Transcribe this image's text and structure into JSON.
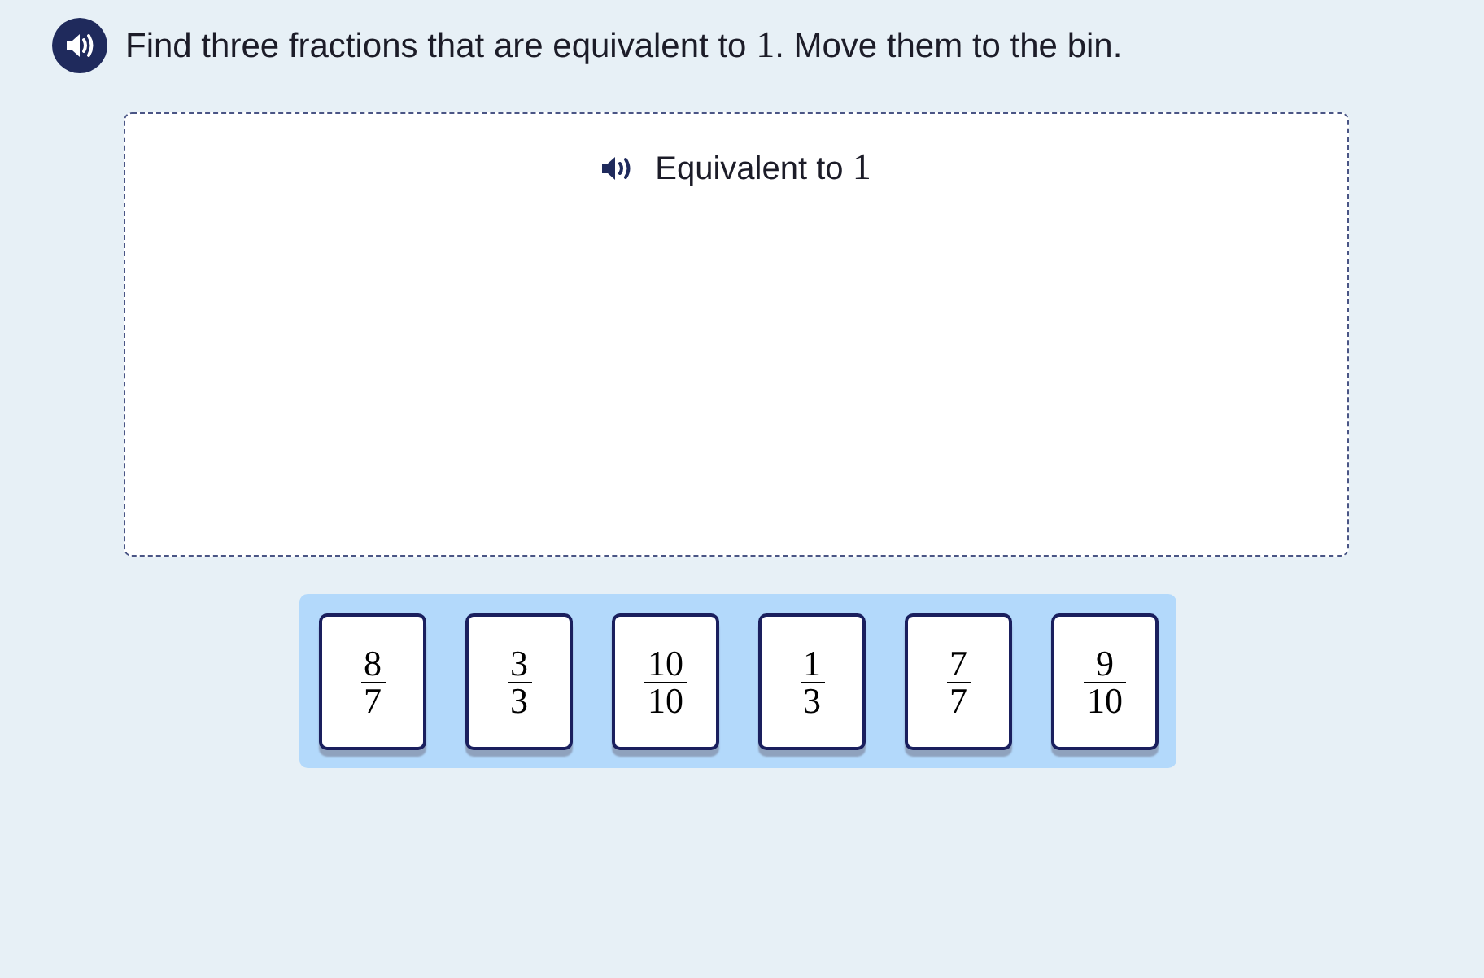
{
  "instruction": {
    "parts": [
      {
        "kind": "text",
        "text": "Find three fractions that are equivalent to "
      },
      {
        "kind": "math",
        "text": "1"
      },
      {
        "kind": "text",
        "text": ". Move them to the bin."
      }
    ]
  },
  "bin": {
    "title_parts": [
      {
        "kind": "text",
        "text": "Equivalent to "
      },
      {
        "kind": "math",
        "text": "1"
      }
    ]
  },
  "cards": [
    {
      "numerator": "8",
      "denominator": "7"
    },
    {
      "numerator": "3",
      "denominator": "3"
    },
    {
      "numerator": "10",
      "denominator": "10"
    },
    {
      "numerator": "1",
      "denominator": "3"
    },
    {
      "numerator": "7",
      "denominator": "7"
    },
    {
      "numerator": "9",
      "denominator": "10"
    }
  ]
}
